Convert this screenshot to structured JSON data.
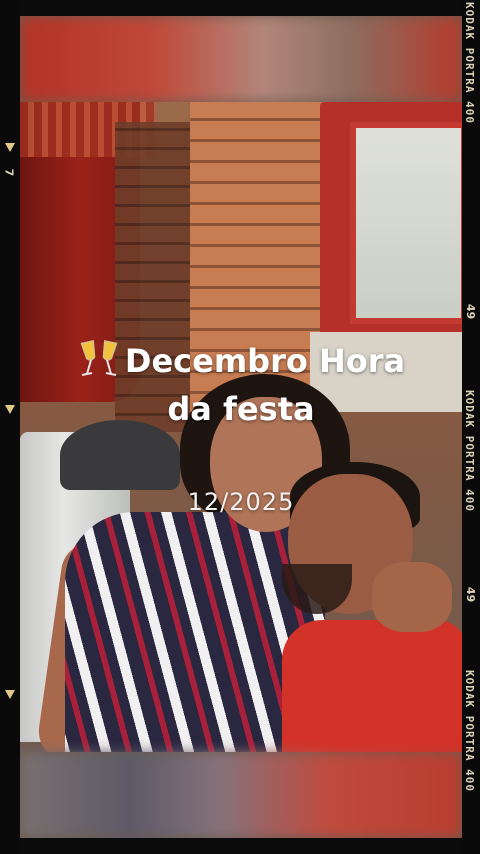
{
  "film": {
    "brand_text": "KODAK PORTRA 400",
    "frame_number": "49",
    "left_marker": "7"
  },
  "overlay": {
    "emoji": "🥂",
    "title_line1": "Decembro Hora",
    "title_line2": "da festa",
    "date": "12/2025"
  }
}
